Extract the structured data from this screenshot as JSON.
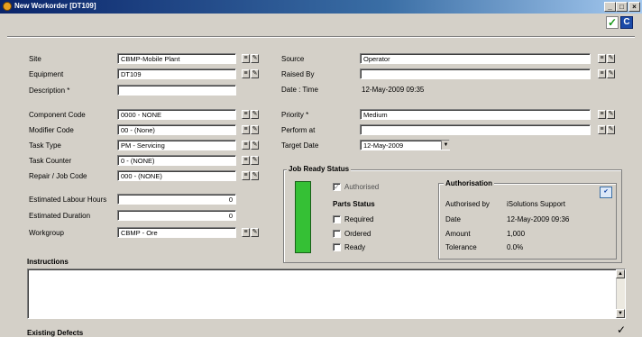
{
  "window": {
    "title": "New Workorder [DT109]",
    "minimize": "_",
    "maximize": "□",
    "close": "×"
  },
  "toolbar": {
    "ok_icon": "✓",
    "cancel_icon": "C"
  },
  "left_fields": [
    {
      "label": "Site",
      "value": "CBMP-Mobile Plant"
    },
    {
      "label": "Equipment",
      "value": "DT109"
    },
    {
      "label": "Description *",
      "value": ""
    },
    {
      "label": "Component Code",
      "value": "0000 - NONE"
    },
    {
      "label": "Modifier Code",
      "value": "00 - (None)"
    },
    {
      "label": "Task Type",
      "value": "PM - Servicing"
    },
    {
      "label": "Task Counter",
      "value": "0 - (NONE)"
    },
    {
      "label": "Repair / Job Code",
      "value": "000 - (NONE)"
    },
    {
      "label": "Estimated Labour Hours",
      "value": "0"
    },
    {
      "label": "Estimated Duration",
      "value": "0"
    },
    {
      "label": "Workgroup",
      "value": "CBMP - Ore"
    }
  ],
  "right_fields": {
    "source": {
      "label": "Source",
      "value": "Operator"
    },
    "raised_by": {
      "label": "Raised By",
      "value": ""
    },
    "date_time": {
      "label": "Date : Time",
      "value": "12-May-2009 09:35"
    },
    "priority": {
      "label": "Priority *",
      "value": "Medium"
    },
    "perform_at": {
      "label": "Perform at",
      "value": ""
    },
    "target_date": {
      "label": "Target Date",
      "value": "12-May-2009"
    }
  },
  "lookup_icons": {
    "list": "≡",
    "edit": "✎"
  },
  "job_ready": {
    "title": "Job Ready Status",
    "status_color": "#35c035",
    "authorised_label": "Authorised",
    "authorised_checked": true,
    "parts_title": "Parts Status",
    "parts": [
      "Required",
      "Ordered",
      "Ready"
    ]
  },
  "authorisation": {
    "title": "Authorisation",
    "rows": [
      {
        "label": "Authorised by",
        "value": "iSolutions Support"
      },
      {
        "label": "Date",
        "value": "12-May-2009 09:36"
      },
      {
        "label": "Amount",
        "value": "1,000"
      },
      {
        "label": "Tolerance",
        "value": "0.0%"
      }
    ]
  },
  "instructions": {
    "title": "Instructions",
    "value": ""
  },
  "existing_defects": {
    "title": "Existing Defects"
  },
  "scroll": {
    "up": "▲",
    "down": "▼"
  }
}
